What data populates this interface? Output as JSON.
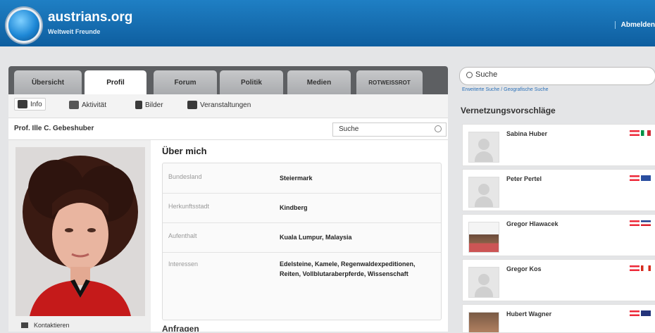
{
  "header": {
    "brand": "austrians.org",
    "tagline": "Weltweit Freunde",
    "logout": "Abmelden"
  },
  "tabs": [
    {
      "label": "Übersicht"
    },
    {
      "label": "Profil"
    },
    {
      "label": "Forum"
    },
    {
      "label": "Politik"
    },
    {
      "label": "Medien"
    },
    {
      "label": "ROTWEISSROT"
    }
  ],
  "subnav": [
    {
      "label": "Info",
      "icon": "info-icon"
    },
    {
      "label": "Aktivität",
      "icon": "activity-icon"
    },
    {
      "label": "Bilder",
      "icon": "images-icon"
    },
    {
      "label": "Veranstaltungen",
      "icon": "calendar-icon"
    }
  ],
  "profile": {
    "name": "Prof. Ille C. Gebeshuber",
    "search_placeholder": "Suche",
    "contact": "Kontaktieren",
    "about_title": "Über mich",
    "rows": [
      {
        "label": "Bundesland",
        "value": "Steiermark"
      },
      {
        "label": "Herkunftsstadt",
        "value": "Kindberg"
      },
      {
        "label": "Aufenthalt",
        "value": "Kuala Lumpur, Malaysia"
      },
      {
        "label": "Interessen",
        "value": "Edelsteine, Kamele, Regenwaldexpeditionen, Reiten, Vollblutaraberpferde, Wissenschaft"
      }
    ],
    "next_section": "Anfragen"
  },
  "sidebar": {
    "search_placeholder": "Suche",
    "advanced_link": "Erweiterte Suche / Geografische Suche",
    "suggestions_title": "Vernetzungsvorschläge",
    "suggestions": [
      {
        "name": "Sabina Huber"
      },
      {
        "name": "Peter Pertel"
      },
      {
        "name": "Gregor Hlawacek"
      },
      {
        "name": "Gregor Kos"
      },
      {
        "name": "Hubert Wagner"
      }
    ]
  }
}
